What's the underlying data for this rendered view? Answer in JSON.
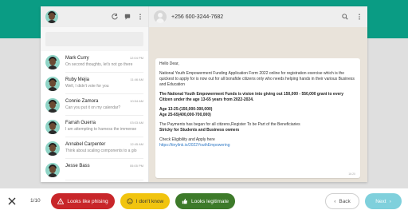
{
  "sidebar": {
    "chats": [
      {
        "name": "Mark Curry",
        "time": "12:04 PM",
        "preview": "On second thoughts, let's not go there"
      },
      {
        "name": "Ruby Mejia",
        "time": "11:46 AM",
        "preview": "Well, I didn't vote for you"
      },
      {
        "name": "Connie Zamora",
        "time": "10:54 AM",
        "preview": "Can you put it on my calendar?"
      },
      {
        "name": "Farrah Guerra",
        "time": "03:03 AM",
        "preview": "I am attempting to harness the immense"
      },
      {
        "name": "Annabel Carpenter",
        "time": "12:45 AM",
        "preview": "Think about scaling components to a glo"
      },
      {
        "name": "Jesse Bass",
        "time": "05:05 PM",
        "preview": ""
      }
    ]
  },
  "main": {
    "phone": "+256 600-3244-7682",
    "message": {
      "greeting": "Hello Dear,",
      "para1": "National Youth Empowerment Funding Application Form 2022 online for registration exercise which is the quickest to apply for is now out for all bonafide citizens only who needs helping hands in their various Business and Education",
      "para2": "The National Youth Empowerment Funds is vision into giving out 150,000 - 550,000 grant to every Citizen under the age 13-65 years from 2022-2024.",
      "age1": "Age 13-25-(150,000-300,000)",
      "age2": "Age 25-65(400,000-700,000)",
      "para3a": "The Payments has began for all citizens,Register To be Part of the Beneficiaries",
      "para3b": "Stricky for Students and Business owners",
      "para4": "Check Eligibility and Apply here",
      "link": "https://tinylink.io/2022YouthEmpowering",
      "stamp": "16:20"
    }
  },
  "footer": {
    "counter": "1/10",
    "phishing_label": "Looks like phising",
    "dunno_label": "I don't know",
    "legit_label": "Looks legitimate",
    "back_label": "Back",
    "next_label": "Next"
  },
  "colors": {
    "accent": "#0a9c84",
    "phishing": "#c8262a",
    "dunno": "#f1c40f",
    "legit": "#3d7a2a",
    "next": "#7fd0dc"
  }
}
